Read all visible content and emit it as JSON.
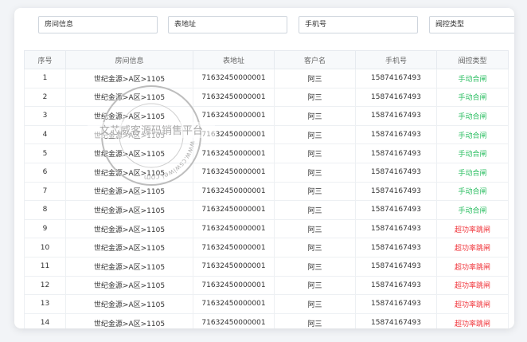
{
  "filters": [
    {
      "label": "房间信息"
    },
    {
      "label": "表地址"
    },
    {
      "label": "手机号"
    },
    {
      "label": "阀控类型"
    }
  ],
  "table": {
    "headers": [
      "序号",
      "房间信息",
      "表地址",
      "客户名",
      "手机号",
      "阀控类型"
    ],
    "rows": [
      [
        "1",
        "世纪金源>A区>1105",
        "71632450000001",
        "阿三",
        "15874167493",
        "手动合闸"
      ],
      [
        "2",
        "世纪金源>A区>1105",
        "71632450000001",
        "阿三",
        "15874167493",
        "手动合闸"
      ],
      [
        "3",
        "世纪金源>A区>1105",
        "71632450000001",
        "阿三",
        "15874167493",
        "手动合闸"
      ],
      [
        "4",
        "世纪金源>A区>1105",
        "71632450000001",
        "阿三",
        "15874167493",
        "手动合闸"
      ],
      [
        "5",
        "世纪金源>A区>1105",
        "71632450000001",
        "阿三",
        "15874167493",
        "手动合闸"
      ],
      [
        "6",
        "世纪金源>A区>1105",
        "71632450000001",
        "阿三",
        "15874167493",
        "手动合闸"
      ],
      [
        "7",
        "世纪金源>A区>1105",
        "71632450000001",
        "阿三",
        "15874167493",
        "手动合闸"
      ],
      [
        "8",
        "世纪金源>A区>1105",
        "71632450000001",
        "阿三",
        "15874167493",
        "手动合闸"
      ],
      [
        "9",
        "世纪金源>A区>1105",
        "71632450000001",
        "阿三",
        "15874167493",
        "超功率跳闸"
      ],
      [
        "10",
        "世纪金源>A区>1105",
        "71632450000001",
        "阿三",
        "15874167493",
        "超功率跳闸"
      ],
      [
        "11",
        "世纪金源>A区>1105",
        "71632450000001",
        "阿三",
        "15874167493",
        "超功率跳闸"
      ],
      [
        "12",
        "世纪金源>A区>1105",
        "71632450000001",
        "阿三",
        "15874167493",
        "超功率跳闸"
      ],
      [
        "13",
        "世纪金源>A区>1105",
        "71632450000001",
        "阿三",
        "15874167493",
        "超功率跳闸"
      ],
      [
        "14",
        "世纪金源>A区>1105",
        "71632450000001",
        "阿三",
        "15874167493",
        "超功率跳闸"
      ],
      [
        "15",
        "世纪金源>A区>1105",
        "71632450000001",
        "阿三",
        "15874167493",
        "超功率跳闸"
      ]
    ]
  },
  "status_colors": {
    "手动合闸": "#2dbf63",
    "超功率跳闸": "#f0343a"
  },
  "watermark": {
    "center_text": "文芯威客源码销售平台",
    "ring_text": "www.cswiwei.com",
    "stamp_color": "#9a9a9a"
  }
}
